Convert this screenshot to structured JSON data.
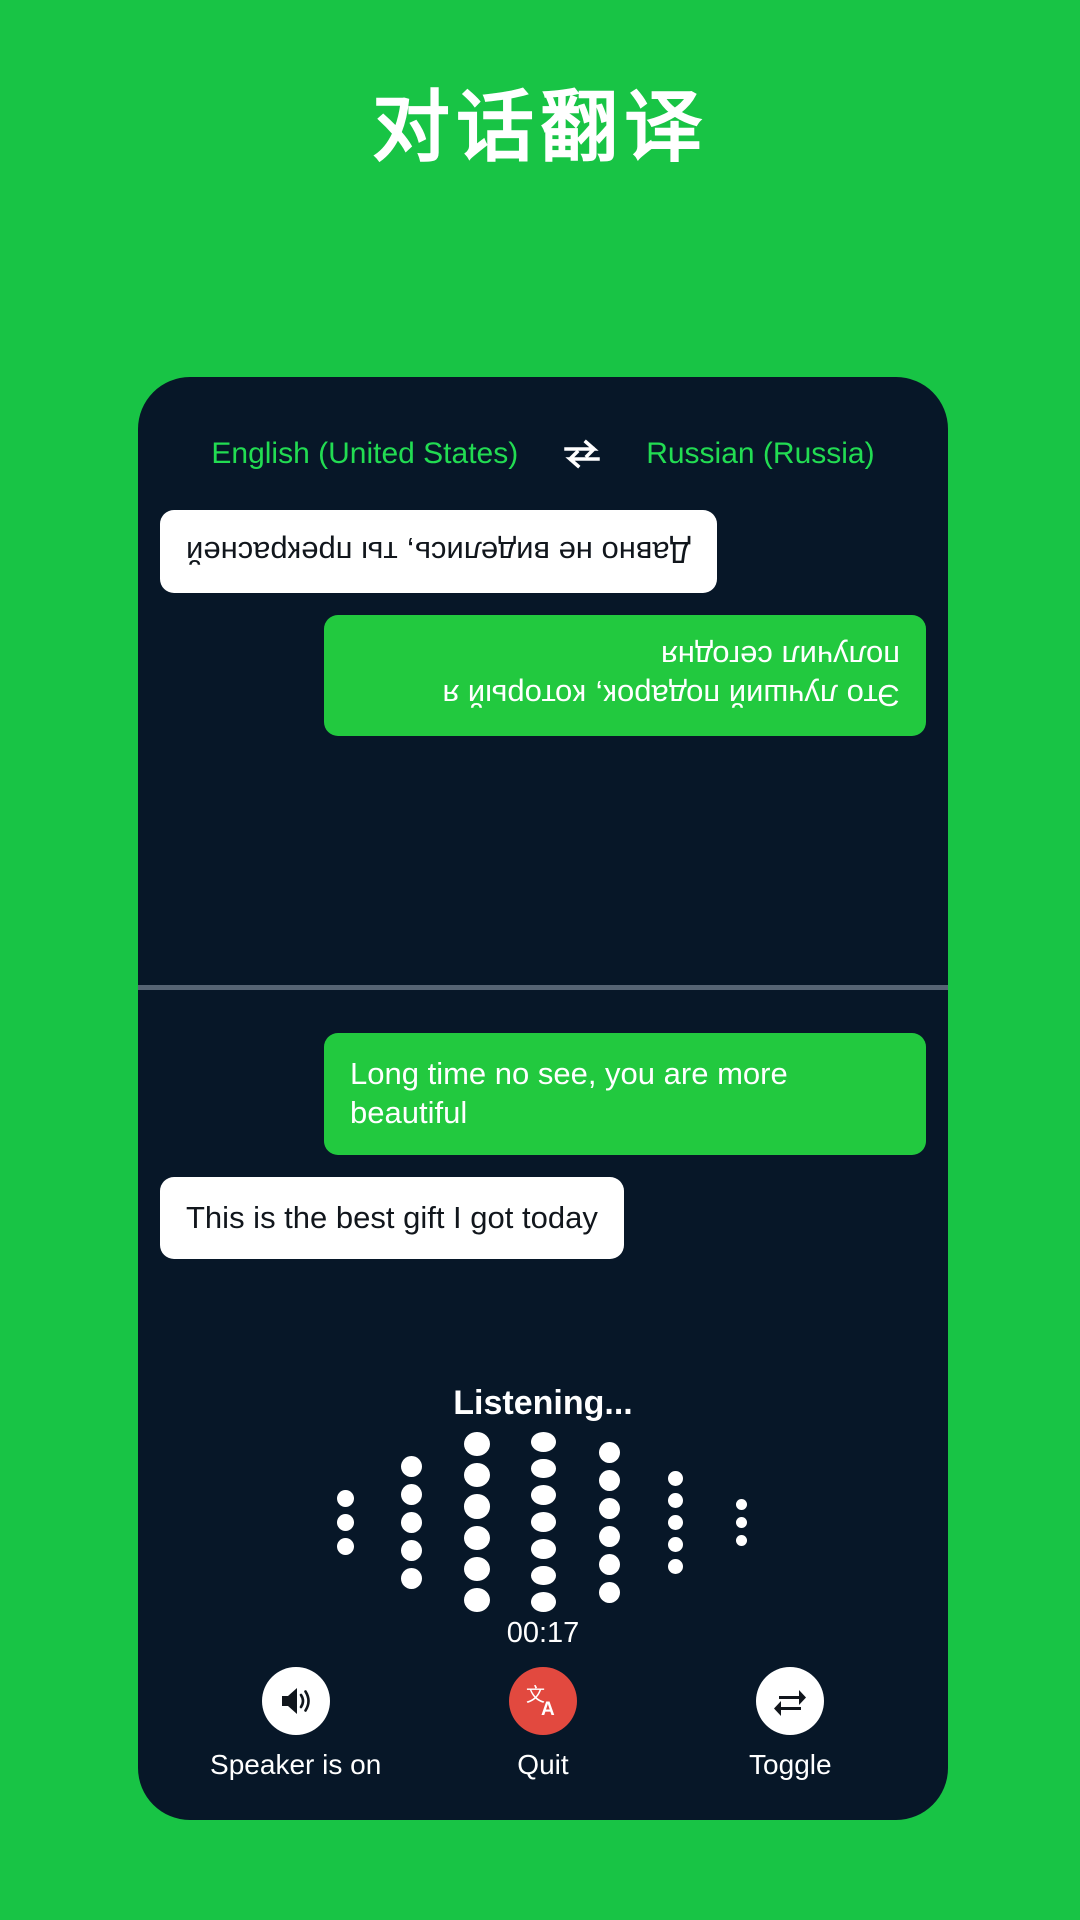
{
  "page": {
    "title": "对话翻译",
    "background_color": "#18C445",
    "panel_color": "#071728"
  },
  "language_bar": {
    "source_language": "English (United States)",
    "target_language": "Russian (Russia)",
    "swap_icon": "swap-horizontal-icon",
    "text_color": "#22DC52"
  },
  "conversation": {
    "upper_pane_rotated": true,
    "upper_messages": [
      {
        "text": "Это лучший подарок, который я получил сегодня",
        "style": "green",
        "align": "left"
      },
      {
        "text": "Давно не виделись, ты прекрасней",
        "style": "white",
        "align": "right"
      }
    ],
    "lower_messages": [
      {
        "text": "Long time no see, you are more beautiful",
        "style": "green",
        "align": "right"
      },
      {
        "text": "This is the best gift I got today",
        "style": "white",
        "align": "left"
      }
    ],
    "bubble_green": "#22C93F",
    "bubble_white": "#ffffff"
  },
  "status": {
    "listening_label": "Listening...",
    "timer": "00:17"
  },
  "waveform": {
    "columns": [
      {
        "count": 3,
        "size": 17
      },
      {
        "count": 5,
        "size": 21
      },
      {
        "count": 6,
        "size": 26
      },
      {
        "count": 7,
        "size": 25
      },
      {
        "count": 6,
        "size": 21
      },
      {
        "count": 5,
        "size": 15
      },
      {
        "count": 3,
        "size": 11
      }
    ],
    "dot_color": "#ffffff"
  },
  "controls": [
    {
      "id": "speaker",
      "label": "Speaker is on",
      "icon": "speaker-on-icon",
      "circle_color": "#ffffff",
      "icon_color": "#11161c"
    },
    {
      "id": "quit",
      "label": "Quit",
      "icon": "translate-icon",
      "circle_color": "#E2493F",
      "icon_color": "#ffffff"
    },
    {
      "id": "toggle",
      "label": "Toggle",
      "icon": "swap-loop-icon",
      "circle_color": "#ffffff",
      "icon_color": "#11161c"
    }
  ]
}
